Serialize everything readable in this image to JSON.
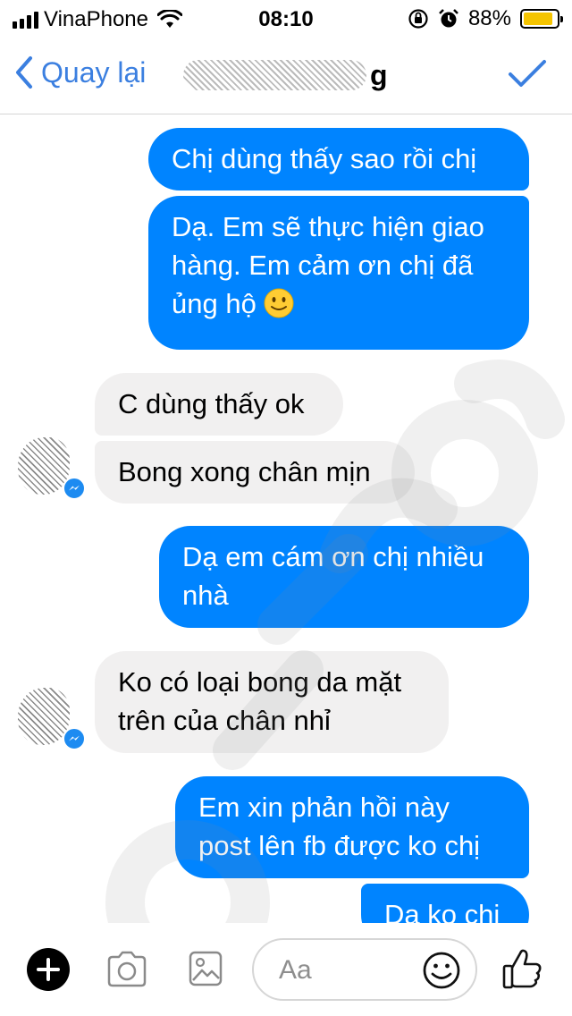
{
  "status_bar": {
    "carrier": "VinaPhone",
    "time": "08:10",
    "battery": "88%",
    "battery_level": 0.88
  },
  "nav": {
    "back_label": "Quay lại",
    "contact_name_visible": "g"
  },
  "messages": [
    {
      "direction": "outgoing",
      "text": "Chị dùng thấy sao rồi chị"
    },
    {
      "direction": "outgoing",
      "lines": [
        "Dạ. Em sẽ thực hiện giao",
        "hàng. Em cảm ơn chị đã",
        "ủng hộ"
      ],
      "emoji": "slightly-smiling-face"
    },
    {
      "direction": "incoming",
      "text": "C dùng thấy ok"
    },
    {
      "direction": "incoming",
      "text": "Bong xong chân mịn"
    },
    {
      "direction": "outgoing",
      "lines": [
        "Dạ em cám ơn chị nhiều",
        "nhà"
      ]
    },
    {
      "direction": "incoming",
      "lines": [
        "Ko có loại bong da mặt",
        "trên của chân nhỉ"
      ]
    },
    {
      "direction": "outgoing",
      "lines": [
        "Em xin phản hồi này",
        "post lên fb được ko chị"
      ]
    },
    {
      "direction": "outgoing",
      "text": "Dạ ko chị"
    }
  ],
  "composer": {
    "placeholder": "Aa"
  },
  "colors": {
    "accent": "#3b7fe0",
    "outgoing_bubble": "#0084ff",
    "incoming_bubble": "#f1f0f0",
    "battery": "#f5c400"
  },
  "icons": [
    "signal-icon",
    "wifi-icon",
    "orientation-lock-icon",
    "alarm-icon",
    "battery-icon",
    "back-chevron-icon",
    "checkmark-icon",
    "messenger-badge-icon",
    "plus-icon",
    "camera-icon",
    "image-icon",
    "emoji-icon",
    "thumbs-up-icon"
  ]
}
